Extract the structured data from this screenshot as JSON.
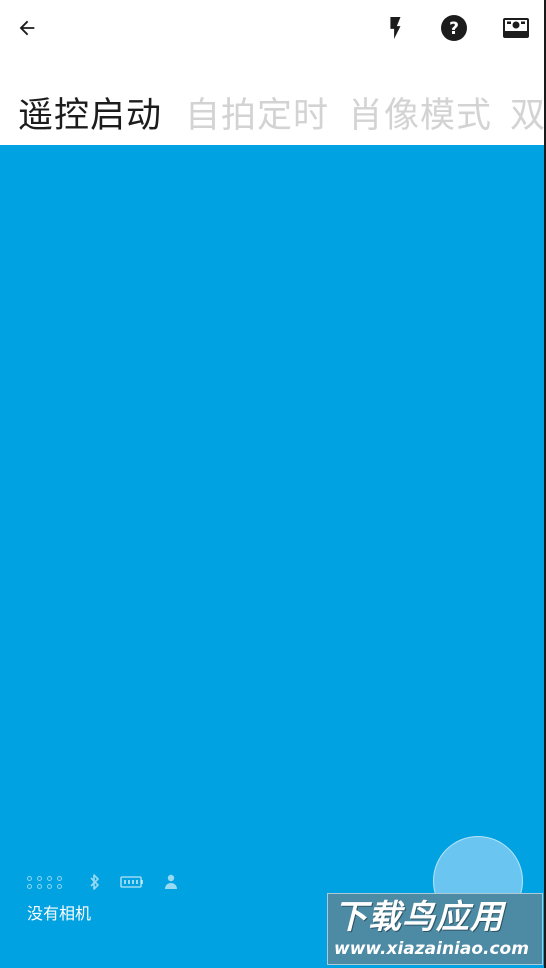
{
  "header": {
    "back_icon": "arrow-left-icon",
    "flash_icon": "flash-icon",
    "help_icon": "help-icon",
    "camera_icon": "camera-icon"
  },
  "modes": [
    {
      "label": "遥控启动",
      "active": true
    },
    {
      "label": "自拍定时",
      "active": false
    },
    {
      "label": "肖像模式",
      "active": false
    },
    {
      "label": "双",
      "active": false
    }
  ],
  "status": {
    "dots_icon": "dots-grid-icon",
    "bluetooth_icon": "bluetooth-icon",
    "battery_icon": "battery-icon",
    "person_icon": "person-icon",
    "label": "没有相机"
  },
  "watermark": {
    "top": "下载鸟应用",
    "bottom": "www.xiazainiao.com"
  },
  "colors": {
    "viewport": "#00a2e1",
    "shutter": "#6ac6f0",
    "inactive_mode": "#d3d3d3",
    "active_mode": "#1c1c1c"
  }
}
